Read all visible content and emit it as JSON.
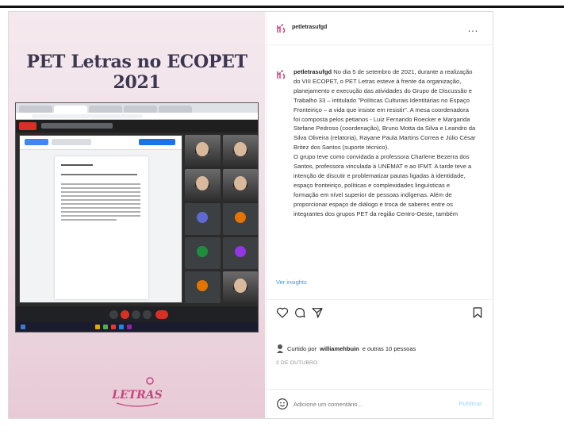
{
  "post": {
    "image_title": "PET Letras no ECOPET 2021",
    "logo_text": "LETRAS"
  },
  "side": {
    "username": "petletrasufgd",
    "more": "…",
    "caption_user": "petletrasufgd",
    "caption_lines": [
      "No dia 5 de setembro de 2021, durante a realização",
      "do VIII ECOPET, o PET Letras esteve à frente da organização,",
      "planejamento e execução das atividades do Grupo de Discussão e",
      "Trabalho 33 – intitulado \"Políticas Culturais Identitárias no Espaço",
      "Fronteiriço – a vida que insiste em resistir\". A mesa coordenadora",
      "foi composta pelos petianos - Luiz Fernando Roecker e Margarida",
      "Stefane Pedroso (coordenação), Bruno Motta da Silva e Leandro da",
      "Silva Oliveira (relatoria), Rayane Paula Martins Correa e Júlio César",
      "Britez dos Santos (suporte técnico).",
      "O grupo teve como convidada a professora Charlene Bezerra dos",
      "Santos, professora vinculada à UNEMAT e ao IFMT. A tarde teve a",
      "intenção de discutir e problematizar pautas ligadas à identidade,",
      "espaço fronteiriço, políticas e complexidades linguísticas e",
      "formação em nível superior de pessoas indígenas. Além de",
      "proporcionar espaço de diálogo e troca de saberes entre os",
      "integrantes dos grupos PET da região Centro-Oeste, também"
    ],
    "see_insights": "Ver insights",
    "likes_prefix": "Curtido por",
    "likes_user": "williamehbuin",
    "likes_suffix": "e outras 10 pessoas",
    "date": "2 DE OUTUBRO",
    "comment_placeholder": "Adicione um comentário...",
    "publish": "Publicar"
  },
  "colors": {
    "brand_pink": "#c6467d",
    "link_blue": "#3897f0",
    "publish_disabled": "#b2dffc"
  },
  "icons": [
    "heart-icon",
    "comment-icon",
    "share-icon",
    "bookmark-icon",
    "emoji-icon",
    "more-icon"
  ]
}
